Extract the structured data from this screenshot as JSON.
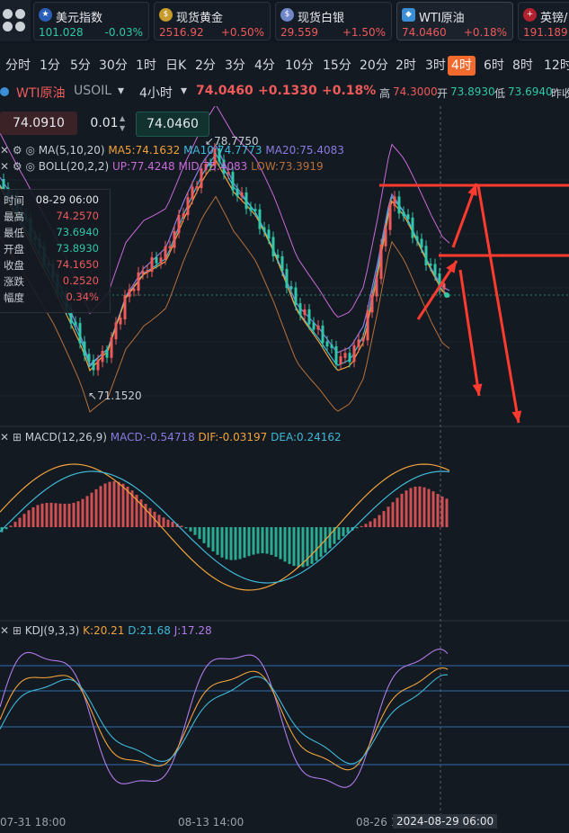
{
  "quotes": [
    {
      "name": "美元指数",
      "price": "101.028",
      "change": "-0.03%",
      "up": false,
      "icon": "us-flag-icon"
    },
    {
      "name": "现货黄金",
      "price": "2516.92",
      "change": "+0.50%",
      "up": true,
      "icon": "gold-icon"
    },
    {
      "name": "现货白银",
      "price": "29.559",
      "change": "+1.50%",
      "up": true,
      "icon": "silver-icon"
    },
    {
      "name": "WTI原油",
      "price": "74.0460",
      "change": "+0.18%",
      "up": true,
      "icon": "oil-icon"
    },
    {
      "name": "英镑/",
      "price": "191.189",
      "change": "",
      "up": true,
      "icon": "uk-flag-icon"
    }
  ],
  "timeframes": [
    "分时",
    "1分",
    "5分",
    "30分",
    "1时",
    "日K",
    "2分",
    "3分",
    "4分",
    "10分",
    "15分",
    "20分",
    "2时",
    "3时",
    "4时",
    "6时",
    "8时",
    "12时"
  ],
  "active_timeframe": "4时",
  "symbol": {
    "name": "WTI原油",
    "code": "USOIL",
    "period": "4小时",
    "price": "74.0460",
    "change": "+0.1330",
    "pct": "+0.18%",
    "high_label": "高",
    "high": "74.3000",
    "open_label": "开",
    "open": "73.8930",
    "low_label": "低",
    "low": "73.6940",
    "prev_label": "昨收"
  },
  "order": {
    "sell_price": "74.0910",
    "lot": "0.01",
    "buy_price": "74.0460"
  },
  "ma": {
    "label": "MA(5,10,20)",
    "ma5": "MA5:74.1632",
    "ma10": "MA10:74.7773",
    "ma20": "MA20:75.4083"
  },
  "boll": {
    "label": "BOLL(20,2,2)",
    "up": "UP:77.4248",
    "mid": "MID:75.4083",
    "low": "LOW:73.3919"
  },
  "price_marks": {
    "high": "78.7750",
    "low": "71.1520"
  },
  "info": {
    "rows": [
      {
        "k": "时间",
        "v": "08-29 06:00",
        "c": "#e6e8ec"
      },
      {
        "k": "最高",
        "v": "74.2570",
        "c": "#ef5a5a"
      },
      {
        "k": "最低",
        "v": "73.6940",
        "c": "#2ec7a8"
      },
      {
        "k": "开盘",
        "v": "73.8930",
        "c": "#2ec7a8"
      },
      {
        "k": "收盘",
        "v": "74.1650",
        "c": "#ef5a5a"
      },
      {
        "k": "涨跌",
        "v": "0.2520",
        "c": "#ef5a5a"
      },
      {
        "k": "幅度",
        "v": "0.34%",
        "c": "#ef5a5a"
      }
    ]
  },
  "macd": {
    "label": "MACD(12,26,9)",
    "macd": "MACD:-0.54718",
    "dif": "DIF:-0.03197",
    "dea": "DEA:0.24162"
  },
  "kdj": {
    "label": "KDJ(9,3,3)",
    "k": "K:20.21",
    "d": "D:21.68",
    "j": "J:17.28"
  },
  "time_axis": {
    "t1": "07-31 18:00",
    "t2": "08-13 14:00",
    "t3": "08-26 1",
    "t4": "2024-08-29 06:00"
  },
  "colors": {
    "up": "#ef5a5a",
    "down": "#2ec7a8",
    "accent": "#f26a2e",
    "ma5": "#f0a23b",
    "ma10": "#3fb8d8",
    "ma20": "#8a7ae0",
    "boll_up": "#c86ad9",
    "boll_low": "#b5703a",
    "arrow": "#ff3b30"
  }
}
